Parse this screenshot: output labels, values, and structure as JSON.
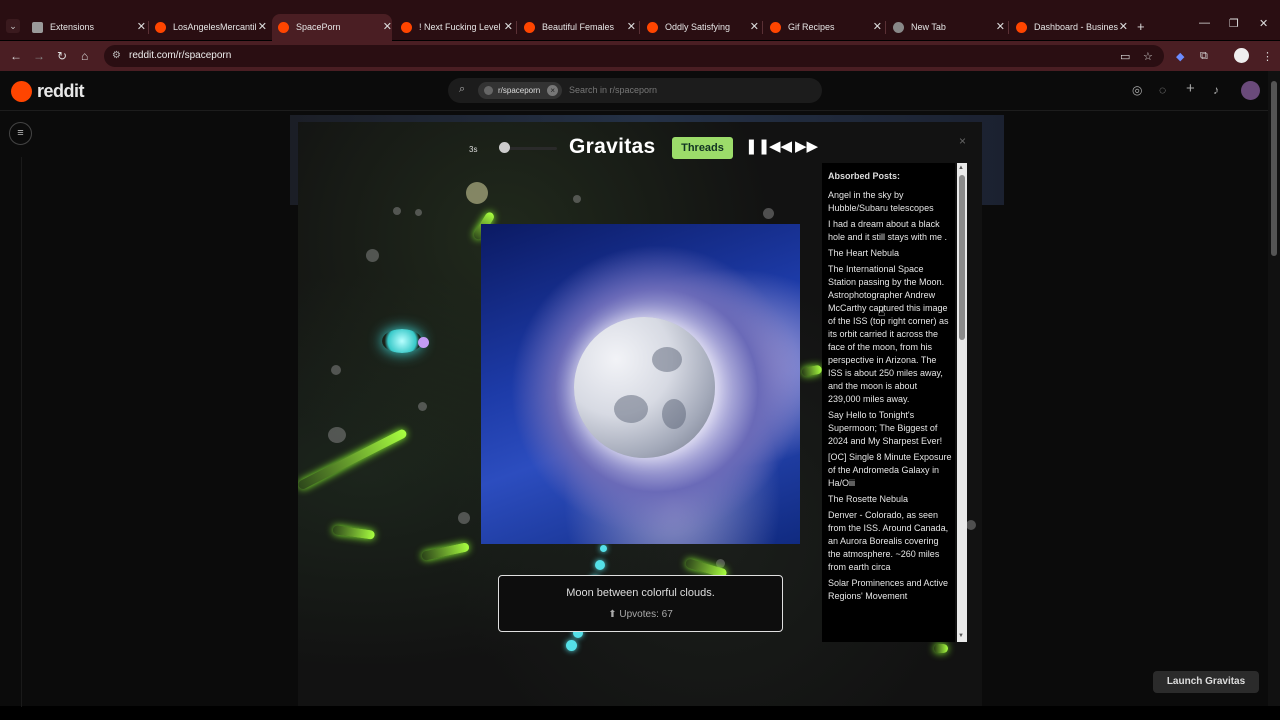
{
  "tabs": [
    {
      "label": "Extensions",
      "icon": "puzzle-icon"
    },
    {
      "label": "LosAngelesMercantil",
      "icon": "reddit-icon"
    },
    {
      "label": "SpacePorn",
      "icon": "reddit-icon",
      "active": true
    },
    {
      "label": "! Next Fucking Level",
      "icon": "reddit-icon"
    },
    {
      "label": "Beautiful Females",
      "icon": "reddit-icon"
    },
    {
      "label": "Oddly Satisfying",
      "icon": "reddit-icon"
    },
    {
      "label": "Gif Recipes",
      "icon": "reddit-icon"
    },
    {
      "label": "New Tab",
      "icon": "globe-icon"
    },
    {
      "label": "Dashboard - Busines",
      "icon": "reddit-icon"
    }
  ],
  "address": {
    "url": "reddit.com/r/spaceporn"
  },
  "reddit": {
    "logo_text": "reddit",
    "search_chip": "r/spaceporn",
    "search_placeholder": "Search in r/spaceporn"
  },
  "gravitas": {
    "speed": "3s",
    "title": "Gravitas",
    "threads_label": "Threads",
    "close_glyph": "×",
    "caption_title": "Moon between colorful clouds.",
    "upvotes_label": "Upvotes: 67",
    "panel_heading": "Absorbed Posts:",
    "absorbed_posts": [
      "Angel in the sky by Hubble/Subaru telescopes",
      "I had a dream about a black hole and it still stays with me .",
      "The Heart Nebula",
      "The International Space Station passing by the Moon. Astrophotographer Andrew McCarthy captured this image of the ISS (top right corner) as its orbit carried it across the face of the moon, from his perspective in Arizona. The ISS is about 250 miles away, and the moon is about 239,000 miles away.",
      "Say Hello to Tonight's Supermoon; The Biggest of 2024 and My Sharpest Ever!",
      "[OC] Single 8 Minute Exposure of the Andromeda Galaxy in Ha/Oiii",
      "The Rosette Nebula",
      "Denver - Colorado, as seen from the ISS. Around Canada, an Aurora Borealis covering the atmosphere. ~260 miles from earth circa",
      "Solar Prominences and Active Regions' Movement"
    ]
  },
  "launch_label": "Launch Gravitas",
  "colors": {
    "threads_button": "#9cdc6a",
    "reddit_orange": "#ff4500",
    "streak": "#a8ff40"
  }
}
